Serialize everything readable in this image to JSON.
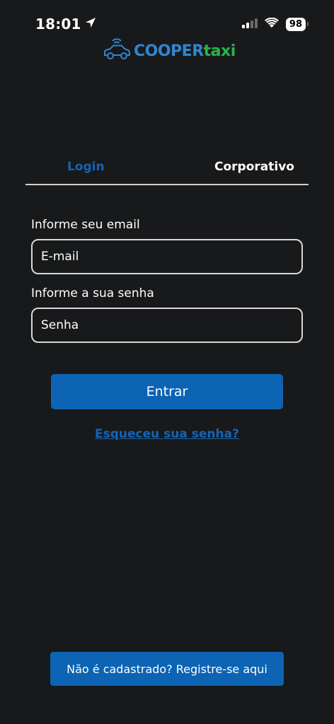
{
  "status_bar": {
    "time": "18:01",
    "battery": "98",
    "icons": [
      "location-arrow-icon",
      "signal-bars-icon",
      "wifi-icon",
      "battery-icon"
    ]
  },
  "logo": {
    "part1": "COOPER",
    "part2": "taxi",
    "icon": "taxi-car-icon",
    "colors": {
      "part1": "#2f86d1",
      "part2": "#2bb24c"
    }
  },
  "tabs": [
    {
      "label": "Login",
      "active": true
    },
    {
      "label": "Corporativo",
      "active": false
    }
  ],
  "form": {
    "email_label": "Informe seu email",
    "email_placeholder": "E-mail",
    "password_label": "Informe a sua senha",
    "password_placeholder": "Senha",
    "submit_label": "Entrar",
    "forgot_link": "Esqueceu sua senha?"
  },
  "register_button": "Não é cadastrado? Registre-se aqui",
  "colors": {
    "background": "#18191b",
    "accent": "#0d63b4",
    "active_tab": "#1564b5"
  }
}
